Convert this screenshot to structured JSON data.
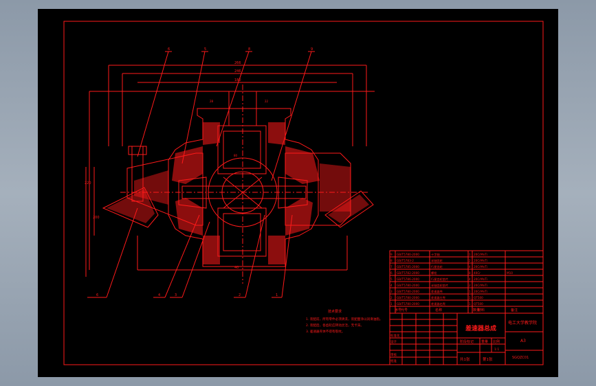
{
  "drawing": {
    "title": "差速器总成",
    "school": "电工大学教学院",
    "sheet_size": "A3",
    "drawing_number": "SGQZC01",
    "sheet_total": "共1张",
    "sheet_index": "第1张",
    "scale": "1:1",
    "scale_header": "比例",
    "weight_header": "重量",
    "mark_header": "阶段标记",
    "designer_label": "设计",
    "checker_label": "审核",
    "approver_label": "批准",
    "standardizer_label": "标准化"
  },
  "dimensions": [
    "266",
    "246",
    "180",
    "220",
    "200",
    "40",
    "80",
    "28",
    "22"
  ],
  "leaders": [
    "6",
    "5",
    "8",
    "9",
    "6",
    "4",
    "3",
    "2",
    "1"
  ],
  "bom": {
    "headers": [
      "序号",
      "代号",
      "名称",
      "数量",
      "材料",
      "备注"
    ],
    "rows": [
      [
        "9",
        "GB/T5780-2000",
        "十字轴",
        "1",
        "20CrMnTi",
        ""
      ],
      [
        "8",
        "GB/T5783-2",
        "半轴齿轮",
        "2",
        "20CrMnTi",
        ""
      ],
      [
        "7",
        "GB/T5785-2000",
        "行星齿轮",
        "4",
        "20CrMnTi",
        ""
      ],
      [
        "6",
        "GB/T5782-2000",
        "螺栓",
        "8",
        "40Cr",
        "M10"
      ],
      [
        "5",
        "GB/T5786-2000",
        "行星齿轮垫片",
        "4",
        "20CrMnTi",
        ""
      ],
      [
        "4",
        "GB/T5780-2000",
        "半轴齿轮垫片",
        "2",
        "20CrMnTi",
        ""
      ],
      [
        "3",
        "GB/T5780-2000",
        "差速器壳",
        "1",
        "20CrMnTi",
        ""
      ],
      [
        "2",
        "GB/T5780-2000",
        "差速器左壳",
        "1",
        "QT500",
        ""
      ],
      [
        "1",
        "GB/T5780-2000",
        "差速器右壳",
        "1",
        "QT500",
        ""
      ]
    ]
  },
  "notes": {
    "heading": "技术要求",
    "lines": [
      "1. 装配前，所有零件必须清洗，装配面涂以润滑油脂。",
      "2. 装配后，各齿轮应转动灵活，无卡滞。",
      "3. 差速器壳体不得有裂纹。"
    ]
  }
}
